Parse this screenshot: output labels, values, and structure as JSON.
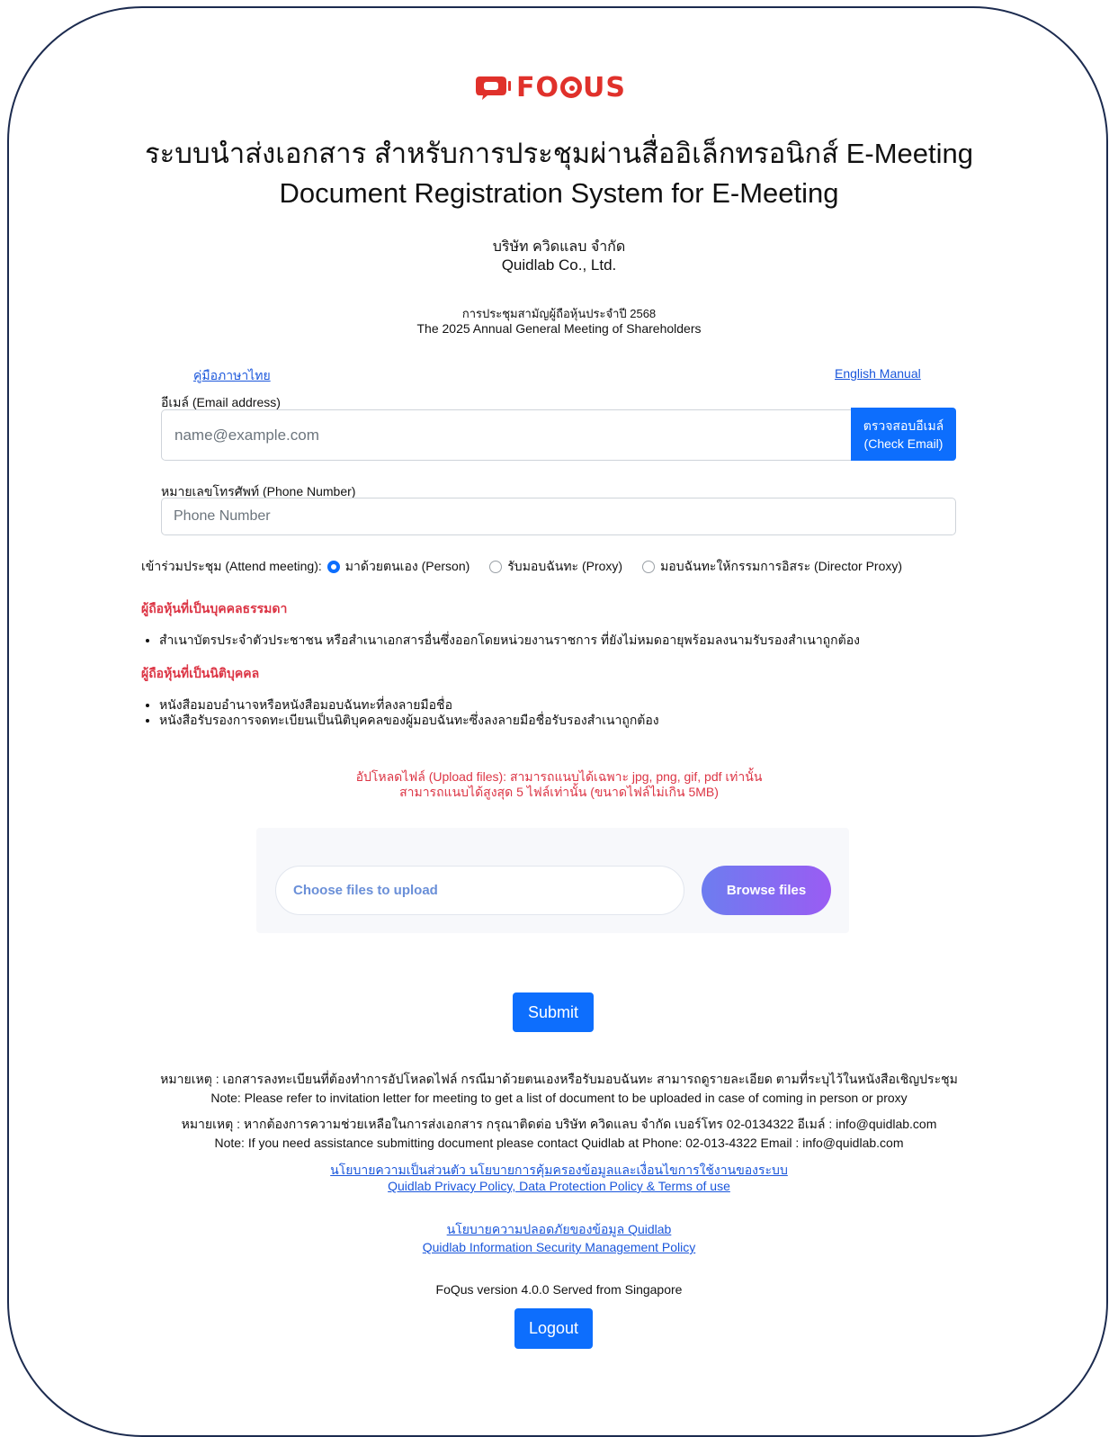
{
  "brand": {
    "name": "FOQUS",
    "name_left": "FO",
    "name_right": "US",
    "color": "#e0312b"
  },
  "header": {
    "title_th": "ระบบนำส่งเอกสาร สำหรับการประชุมผ่านสื่ออิเล็กทรอนิกส์ E-Meeting",
    "title_en": "Document Registration System for E-Meeting",
    "company_th": "บริษัท ควิดแลบ จำกัด",
    "company_en": "Quidlab Co., Ltd.",
    "meeting_th": "การประชุมสามัญผู้ถือหุ้นประจำปี 2568",
    "meeting_en": "The 2025 Annual General Meeting of Shareholders"
  },
  "manuals": {
    "thai": "คู่มือภาษาไทย",
    "english": "English Manual"
  },
  "form": {
    "email_label": "อีเมล์ (Email address)",
    "email_placeholder": "name@example.com",
    "email_value": "",
    "check_email_label_th": "ตรวจสอบอีเมล์",
    "check_email_label_en": "(Check Email)",
    "phone_label": "หมายเลขโทรศัพท์ (Phone Number)",
    "phone_placeholder": "Phone Number",
    "phone_value": "",
    "attend_label": "เข้าร่วมประชุม (Attend meeting):",
    "attend_options": [
      {
        "label": "มาด้วยตนเอง (Person)",
        "selected": true
      },
      {
        "label": "รับมอบฉันทะ (Proxy)",
        "selected": false
      },
      {
        "label": "มอบฉันทะให้กรรมการอิสระ (Director Proxy)",
        "selected": false
      }
    ]
  },
  "requirements": {
    "natural_heading": "ผู้ถือหุ้นที่เป็นบุคคลธรรมดา",
    "natural_items": [
      "สำเนาบัตรประจำตัวประชาชน หรือสำเนาเอกสารอื่นซึ่งออกโดยหน่วยงานราชการ ที่ยังไม่หมดอายุพร้อมลงนามรับรองสำเนาถูกต้อง"
    ],
    "juristic_heading": "ผู้ถือหุ้นที่เป็นนิติบุคคล",
    "juristic_items": [
      "หนังสือมอบอำนาจหรือหนังสือมอบฉันทะที่ลงลายมือชื่อ",
      "หนังสือรับรองการจดทะเบียนเป็นนิติบุคคลของผู้มอบฉันทะซึ่งลงลายมือชื่อรับรองสำเนาถูกต้อง"
    ]
  },
  "upload": {
    "note_line1": "อัปโหลดไฟล์ (Upload files): สามารถแนบได้เฉพาะ jpg, png, gif, pdf เท่านั้น",
    "note_line2": "สามารถแนบได้สูงสุด 5 ไฟล์เท่านั้น (ขนาดไฟล์ไม่เกิน 5MB)",
    "choose_placeholder": "Choose files to upload",
    "browse_label": "Browse files"
  },
  "submit_label": "Submit",
  "notes": {
    "line1": "หมายเหตุ : เอกสารลงทะเบียนที่ต้องทำการอัปโหลดไฟล์ กรณีมาด้วยตนเองหรือรับมอบฉันทะ สามารถดูรายละเอียด ตามที่ระบุไว้ในหนังสือเชิญประชุม",
    "line2": "Note: Please refer to invitation letter for meeting to get a list of document to be uploaded in case of coming in person or proxy",
    "line3": "หมายเหตุ : หากต้องการความช่วยเหลือในการส่งเอกสาร กรุณาติดต่อ บริษัท ควิดแลบ จำกัด เบอร์โทร 02-0134322 อีเมล์ : info@quidlab.com",
    "line4": "Note: If you need assistance submitting document please contact Quidlab at Phone: 02-013-4322 Email : info@quidlab.com"
  },
  "policies": {
    "privacy_th": "นโยบายความเป็นส่วนตัว นโยบายการคุ้มครองข้อมูลและเงื่อนไขการใช้งานของระบบ",
    "privacy_en": "Quidlab Privacy Policy, Data Protection Policy & Terms of use",
    "security_th": "นโยบายความปลอดภัยของข้อมูล Quidlab",
    "security_en": "Quidlab Information Security Management Policy"
  },
  "version_text": "FoQus version 4.0.0 Served from Singapore",
  "logout_label": "Logout",
  "colors": {
    "primary": "#0d6efd",
    "danger": "#dc3545",
    "link": "#1a56db",
    "border": "#1c2b4f"
  }
}
